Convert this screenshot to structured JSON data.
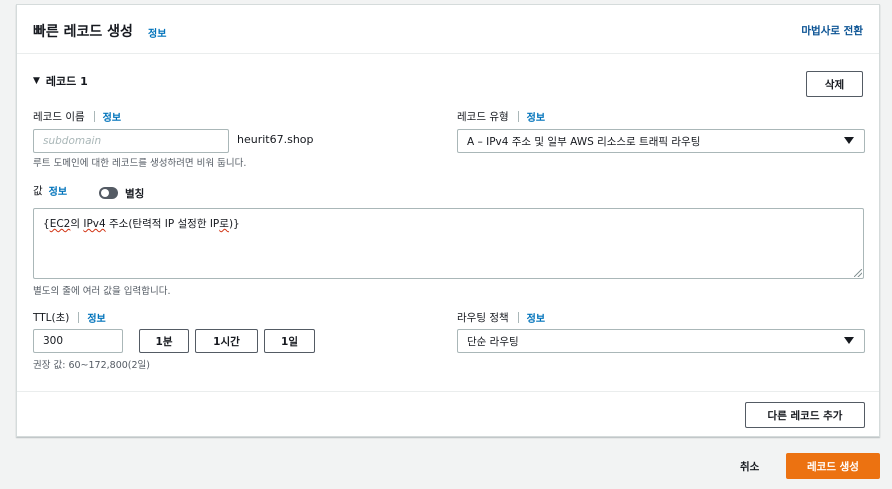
{
  "header": {
    "title": "빠른 레코드 생성",
    "info": "정보",
    "wizard_link": "마법사로 전환"
  },
  "record": {
    "section_title": "레코드 1",
    "delete_label": "삭제",
    "name_label": "레코드 이름",
    "name_info": "정보",
    "name_placeholder": "subdomain",
    "domain_suffix": "heurit67.shop",
    "name_hint": "루트 도메인에 대한 레코드를 생성하려면 비워 둡니다.",
    "type_label": "레코드 유형",
    "type_info": "정보",
    "type_value": "A – IPv4 주소 및 일부 AWS 리소스로 트래픽 라우팅",
    "value_label": "값",
    "value_info": "정보",
    "alias_label": "별칭",
    "value_text_prefix": "{",
    "value_text_ec2": "EC2",
    "value_text_mid": "의 ",
    "value_text_ipv4": "IPv4",
    "value_text_mid2": " 주소(탄력적 IP 설정한 ",
    "value_text_ip": "IP",
    "value_text_ro": "로",
    "value_text_end": ")}",
    "value_hint": "별도의 줄에 여러 값을 입력합니다.",
    "ttl_label": "TTL(초)",
    "ttl_info": "정보",
    "ttl_value": "300",
    "ttl_buttons": [
      "1분",
      "1시간",
      "1일"
    ],
    "ttl_hint": "권장 값: 60~172,800(2일)",
    "routing_label": "라우팅 정책",
    "routing_info": "정보",
    "routing_value": "단순 라우팅",
    "add_record_label": "다른 레코드 추가"
  },
  "footer": {
    "cancel_label": "취소",
    "create_label": "레코드 생성"
  },
  "colors": {
    "primary": "#ec7211",
    "link": "#0073bb"
  }
}
